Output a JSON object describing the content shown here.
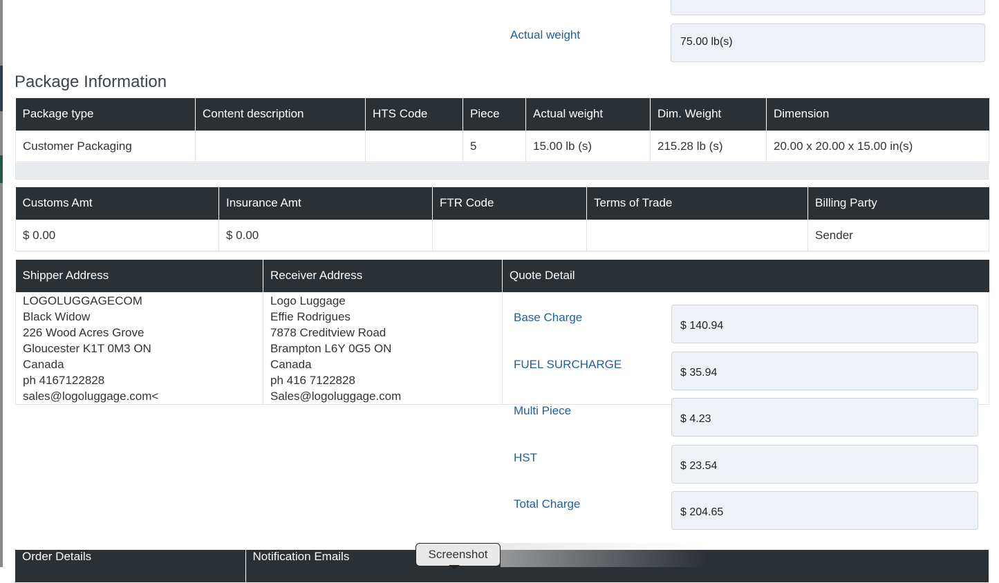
{
  "weight": {
    "label": "Actual weight",
    "value": "75.00 lb(s)"
  },
  "package_section": {
    "title": "Package Information",
    "headers": [
      "Package type",
      "Content description",
      "HTS Code",
      "Piece",
      "Actual weight",
      "Dim. Weight",
      "Dimension"
    ],
    "row": [
      "Customer Packaging",
      "",
      "",
      "5",
      "15.00 lb (s)",
      "215.28 lb (s)",
      "20.00 x 20.00 x 15.00 in(s)"
    ]
  },
  "customs": {
    "headers": [
      "Customs Amt",
      "Insurance Amt",
      "FTR Code",
      "Terms of Trade",
      "Billing Party"
    ],
    "row": [
      "$ 0.00",
      "$ 0.00",
      "",
      "",
      "Sender"
    ]
  },
  "addresses": {
    "shipper_header": "Shipper Address",
    "receiver_header": "Receiver Address",
    "quote_header": "Quote Detail",
    "shipper": [
      "LOGOLUGGAGECOM",
      "Black Widow",
      "226 Wood Acres Grove",
      "Gloucester K1T 0M3 ON",
      "Canada",
      "ph 4167122828",
      "sales@logoluggage.com<"
    ],
    "receiver": [
      "Logo Luggage",
      "Effie Rodrigues",
      "7878 Creditview Road",
      "Brampton L6Y 0G5 ON",
      "Canada",
      "ph 416 7122828",
      "Sales@logoluggage.com"
    ]
  },
  "quote": [
    {
      "label": "Base Charge",
      "value": "$ 140.94"
    },
    {
      "label": "FUEL SURCHARGE",
      "value": "$ 35.94"
    },
    {
      "label": "Multi Piece",
      "value": "$ 4.23"
    },
    {
      "label": "HST",
      "value": "$ 23.54"
    },
    {
      "label": "Total Charge",
      "value": "$ 204.65"
    }
  ],
  "bottom": {
    "order_details": "Order Details",
    "notification_emails": "Notification Emails"
  },
  "tooltip": "Screenshot"
}
